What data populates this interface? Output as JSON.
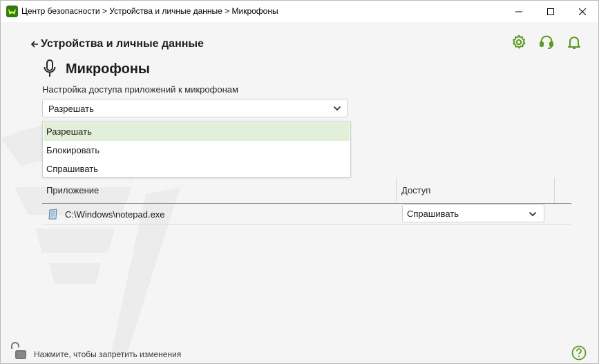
{
  "window": {
    "title": "Центр безопасности > Устройства и личные данные > Микрофоны"
  },
  "header": {
    "back_label": "Устройства и личные данные",
    "page_title": "Микрофоны",
    "icons": [
      "gear-icon",
      "headset-icon",
      "bell-icon"
    ]
  },
  "settings": {
    "access_label": "Настройка доступа приложений к микрофонам",
    "selected": "Разрешать",
    "options": [
      "Разрешать",
      "Блокировать",
      "Спрашивать"
    ]
  },
  "table": {
    "columns": [
      "Приложение",
      "Доступ"
    ],
    "rows": [
      {
        "app": "C:\\Windows\\notepad.exe",
        "access": "Спрашивать"
      }
    ]
  },
  "footer": {
    "lock_text": "Нажмите, чтобы запретить изменения"
  },
  "colors": {
    "accent": "#5a9a1e",
    "selected_item_bg": "#e3f0d9",
    "background": "#f5f5f5"
  }
}
